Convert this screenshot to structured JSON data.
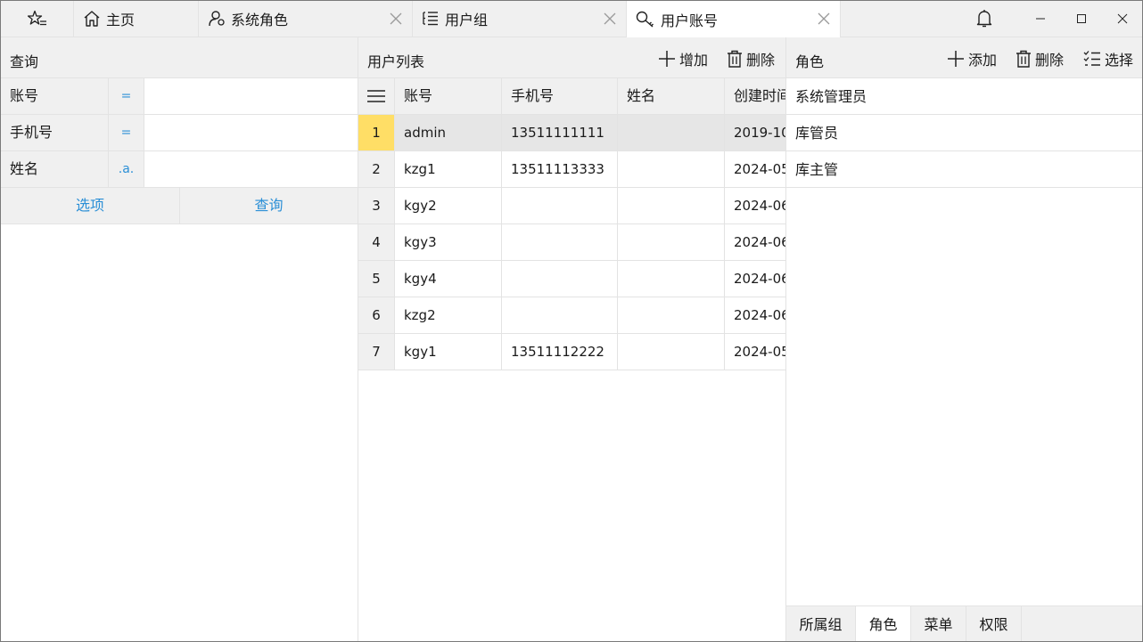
{
  "tabs": [
    {
      "label": "主页",
      "icon": "home-icon",
      "closable": false
    },
    {
      "label": "系统角色",
      "icon": "user-role-icon",
      "closable": true
    },
    {
      "label": "用户组",
      "icon": "list-tree-icon",
      "closable": true
    },
    {
      "label": "用户账号",
      "icon": "key-icon",
      "closable": true,
      "active": true
    }
  ],
  "query": {
    "title": "查询",
    "fields": [
      {
        "label": "账号",
        "op": "=",
        "value": ""
      },
      {
        "label": "手机号",
        "op": "=",
        "value": ""
      },
      {
        "label": "姓名",
        "op": ".a.",
        "value": ""
      }
    ],
    "options_label": "选项",
    "search_label": "查询"
  },
  "users": {
    "title": "用户列表",
    "add_label": "增加",
    "delete_label": "删除",
    "columns": [
      "账号",
      "手机号",
      "姓名",
      "创建时间"
    ],
    "rows": [
      {
        "num": "1",
        "account": "admin",
        "phone": "13511111111",
        "name": "",
        "created": "2019-10",
        "selected": true
      },
      {
        "num": "2",
        "account": "kzg1",
        "phone": "13511113333",
        "name": "",
        "created": "2024-05"
      },
      {
        "num": "3",
        "account": "kgy2",
        "phone": "",
        "name": "",
        "created": "2024-06"
      },
      {
        "num": "4",
        "account": "kgy3",
        "phone": "",
        "name": "",
        "created": "2024-06"
      },
      {
        "num": "5",
        "account": "kgy4",
        "phone": "",
        "name": "",
        "created": "2024-06"
      },
      {
        "num": "6",
        "account": "kzg2",
        "phone": "",
        "name": "",
        "created": "2024-06"
      },
      {
        "num": "7",
        "account": "kgy1",
        "phone": "13511112222",
        "name": "",
        "created": "2024-05"
      }
    ]
  },
  "roles": {
    "title": "角色",
    "add_label": "添加",
    "delete_label": "删除",
    "select_label": "选择",
    "items": [
      "系统管理员",
      "库管员",
      "库主管"
    ],
    "bottom_tabs": [
      {
        "label": "所属组"
      },
      {
        "label": "角色",
        "active": true
      },
      {
        "label": "菜单"
      },
      {
        "label": "权限"
      }
    ]
  },
  "colors": {
    "accent": "#2b8fd6",
    "selected_row": "#ffde66",
    "header_bg": "#f0f0f0"
  }
}
